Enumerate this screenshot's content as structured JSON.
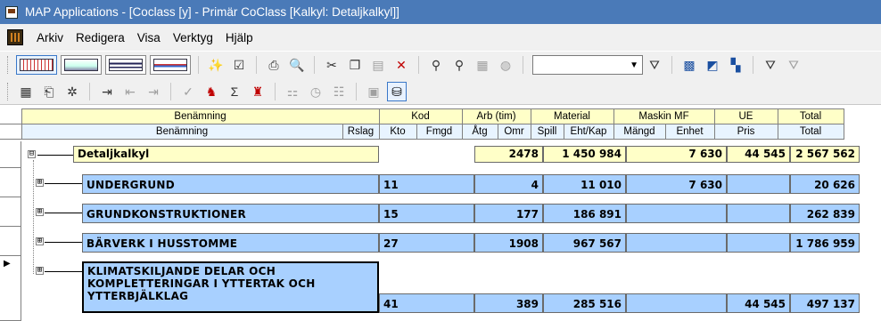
{
  "window": {
    "title": "MAP Applications - [Coclass [y] - Primär CoClass [Kalkyl: Detaljkalkyl]]"
  },
  "menu": {
    "items": [
      "Arkiv",
      "Redigera",
      "Visa",
      "Verktyg",
      "Hjälp"
    ]
  },
  "toolbar": {
    "combo_value": "",
    "icons_row1": [
      "grid-view-icon",
      "chart-view-icon",
      "list-view-icon",
      "report-view-icon",
      "magic-wand-icon",
      "properties-icon",
      "print-icon",
      "print-preview-icon",
      "cut-icon",
      "copy-icon",
      "paste-icon",
      "delete-icon",
      "find-icon",
      "find-next-icon",
      "insert-icon",
      "fill-icon",
      "filter-icon",
      "filter-set-icon",
      "format-icon",
      "tree-icon",
      "filter-funnel-icon",
      "clear-filter-icon"
    ],
    "icons_row2": [
      "table-icon",
      "import-icon",
      "tools-icon",
      "indent-icon",
      "outdent-left-icon",
      "outdent-right-icon",
      "check-icon",
      "calc-icon",
      "calc-sum-icon",
      "calc-total-icon",
      "hierarchy-icon",
      "clock-icon",
      "columns-icon",
      "window-icon",
      "save-db-icon"
    ]
  },
  "grid": {
    "header_row1": {
      "benamning": "Benämning",
      "kod": "Kod",
      "arb": "Arb (tim)",
      "material": "Material",
      "maskin": "Maskin MF",
      "ue": "UE",
      "total": "Total"
    },
    "header_row2": {
      "benamning": "Benämning",
      "rslag": "Rslag",
      "kto": "Kto",
      "fmgd": "Fmgd",
      "atg": "Åtg",
      "omr": "Omr",
      "spill": "Spill",
      "ehtkap": "Eht/Kap",
      "mangd": "Mängd",
      "enhet": "Enhet",
      "pris": "Pris",
      "total": "Total"
    },
    "rows": [
      {
        "name": "Detaljkalkyl",
        "expander": "⊟",
        "kod": "",
        "omr": "2478",
        "material": "1 450 984",
        "maskin": "7 630",
        "ue": "44 545",
        "total": "2 567 562"
      },
      {
        "name": "UNDERGRUND",
        "expander": "⊞",
        "kod": "11",
        "omr": "4",
        "material": "11 010",
        "maskin": "7 630",
        "ue": "",
        "total": "20 626"
      },
      {
        "name": "GRUNDKONSTRUKTIONER",
        "expander": "⊞",
        "kod": "15",
        "omr": "177",
        "material": "186 891",
        "maskin": "",
        "ue": "",
        "total": "262 839"
      },
      {
        "name": "BÄRVERK I HUSSTOMME",
        "expander": "⊞",
        "kod": "27",
        "omr": "1908",
        "material": "967 567",
        "maskin": "",
        "ue": "",
        "total": "1 786 959"
      },
      {
        "name": "KLIMATSKILJANDE DELAR OCH KOMPLETTERINGAR I YTTERTAK OCH YTTERBJÄLKLAG",
        "expander": "⊞",
        "kod": "41",
        "omr": "389",
        "material": "285 516",
        "maskin": "",
        "ue": "44 545",
        "total": "497 137"
      }
    ],
    "current_row_pointer": "▶"
  }
}
